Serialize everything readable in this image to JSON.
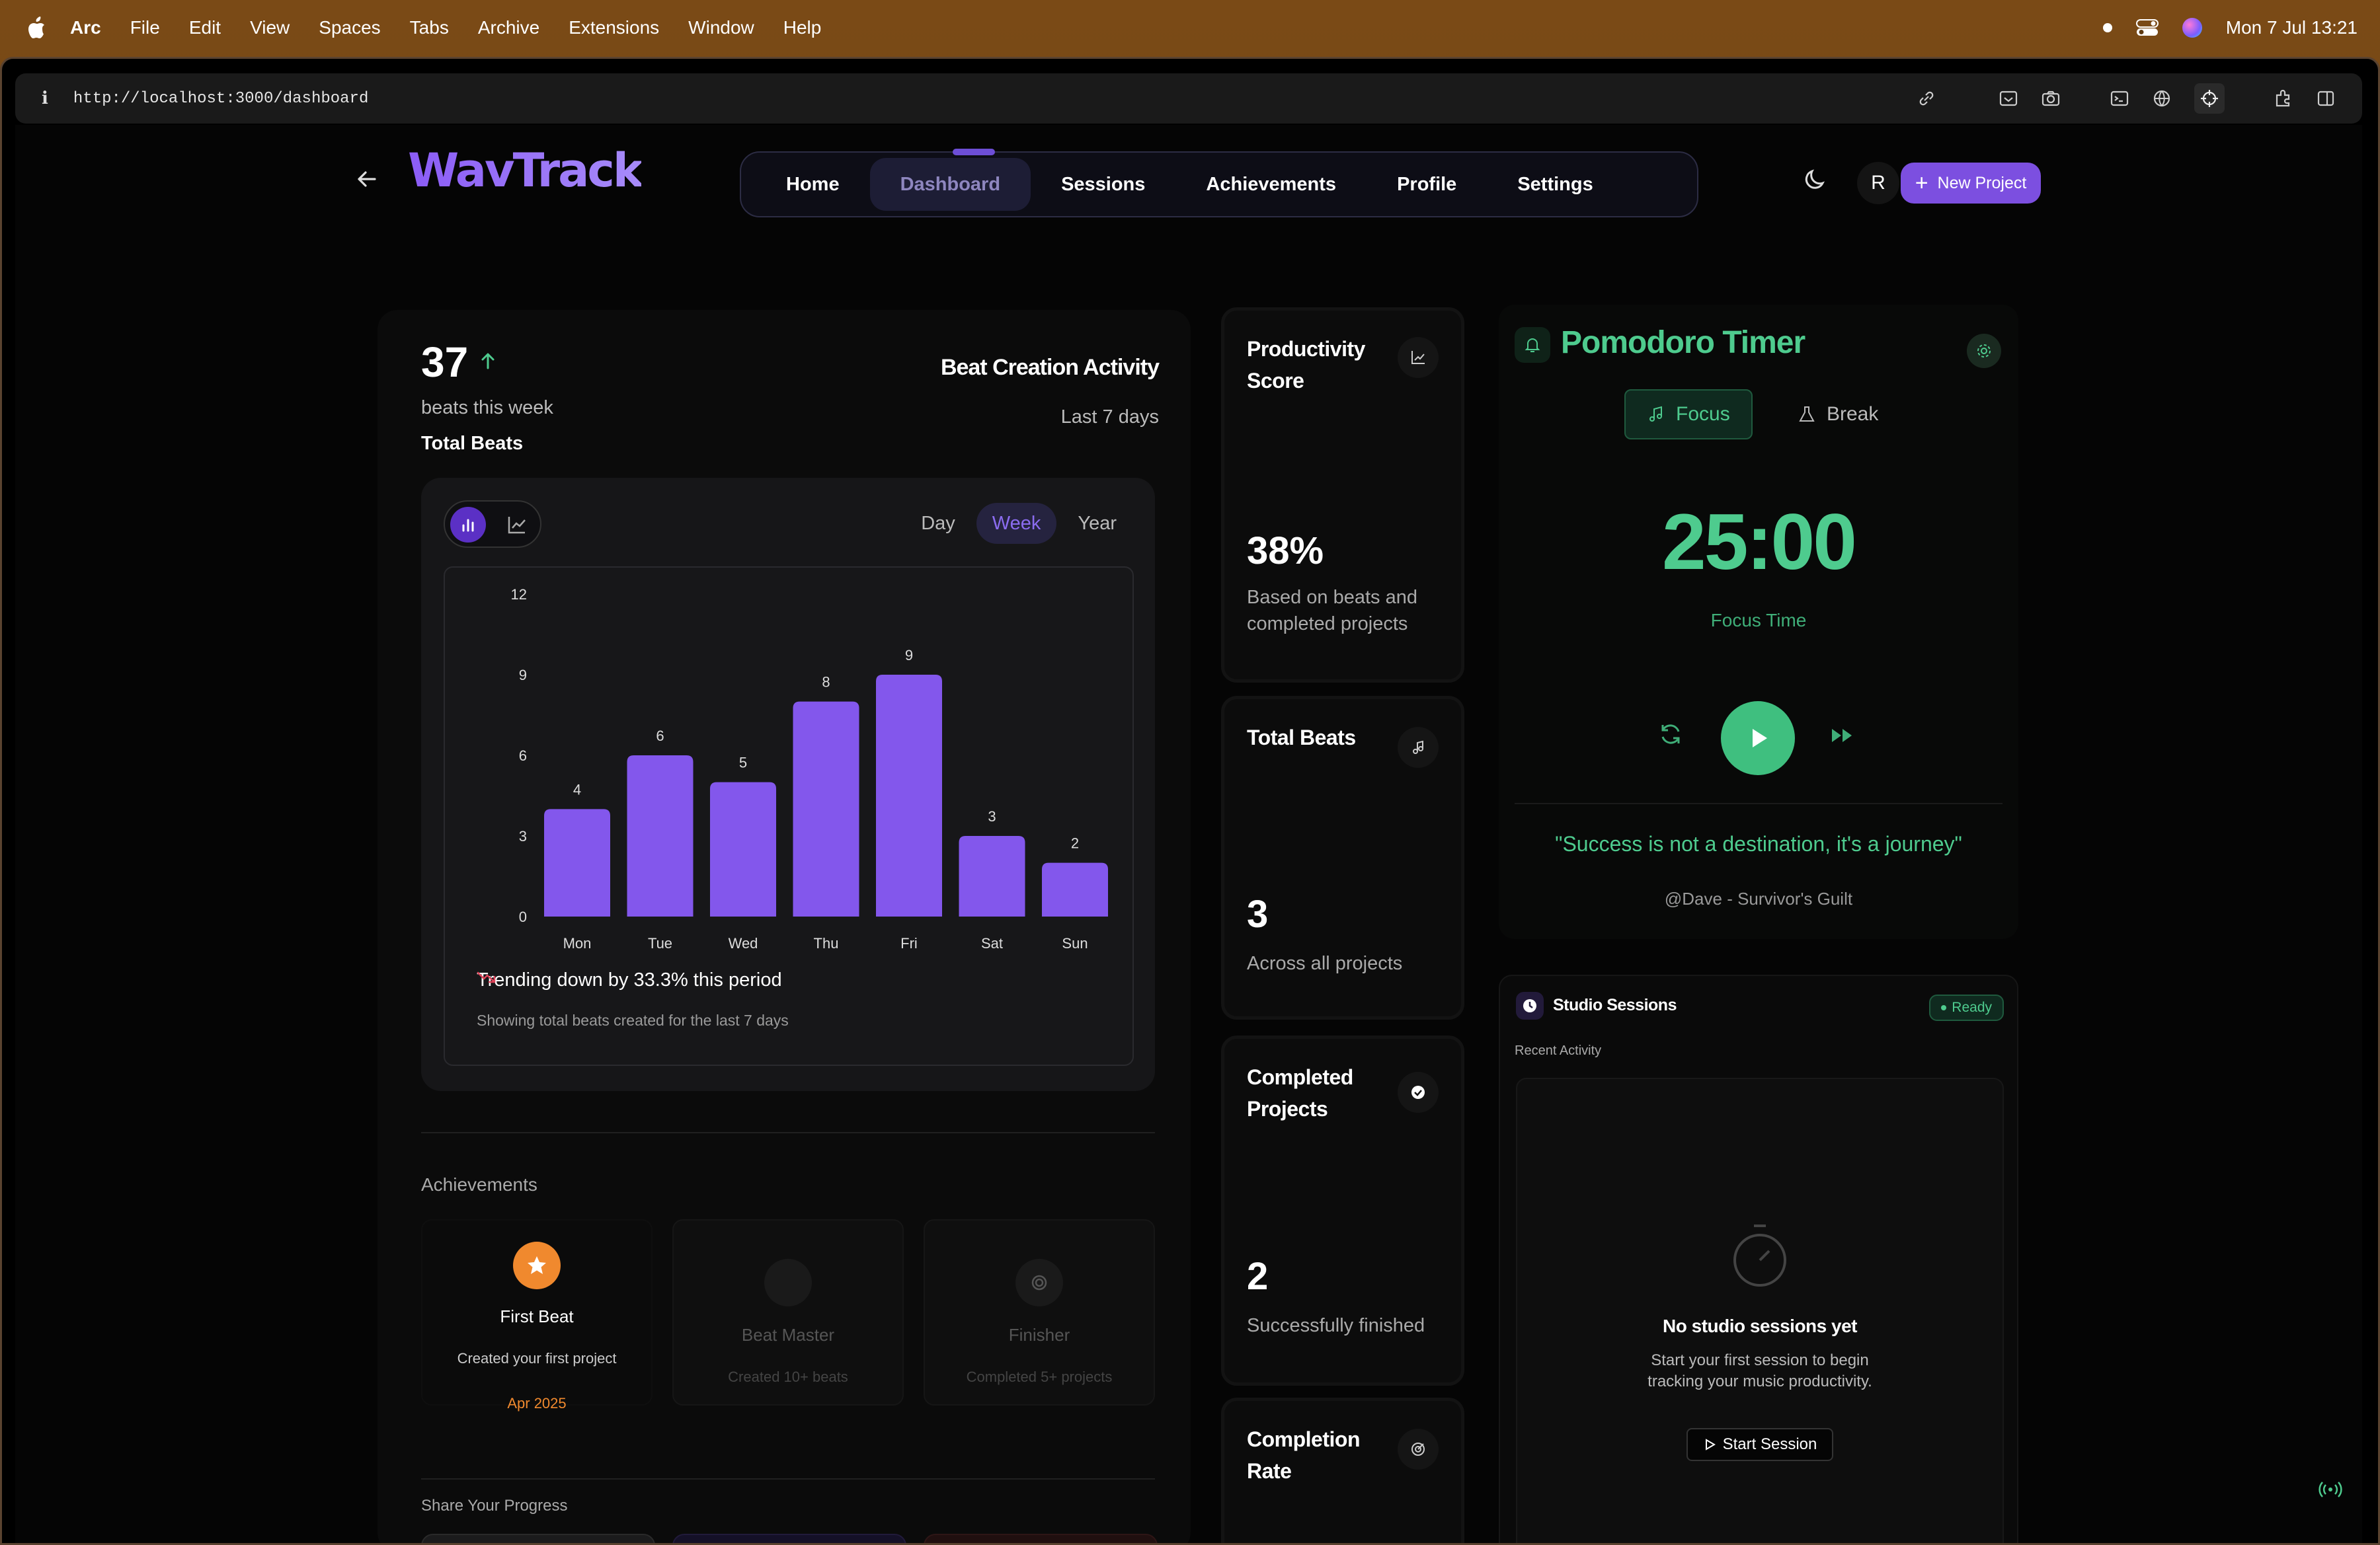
{
  "menubar": {
    "app": "Arc",
    "items": [
      "File",
      "Edit",
      "View",
      "Spaces",
      "Tabs",
      "Archive",
      "Extensions",
      "Window",
      "Help"
    ],
    "datetime": "Mon 7 Jul  13:21"
  },
  "browser": {
    "url": "http://localhost:3000/dashboard"
  },
  "header": {
    "logo": "WavTrack",
    "nav": [
      "Home",
      "Dashboard",
      "Sessions",
      "Achievements",
      "Profile",
      "Settings"
    ],
    "active_nav": "Dashboard",
    "avatar_initial": "R",
    "new_project_label": "New Project"
  },
  "summary": {
    "count": "37",
    "count_label": "beats this week",
    "total_label": "Total Beats",
    "activity_title": "Beat Creation Activity",
    "activity_range": "Last 7 days"
  },
  "periods": [
    "Day",
    "Week",
    "Year"
  ],
  "active_period": "Week",
  "chart_data": {
    "type": "bar",
    "categories": [
      "Mon",
      "Tue",
      "Wed",
      "Thu",
      "Fri",
      "Sat",
      "Sun"
    ],
    "values": [
      4,
      6,
      5,
      8,
      9,
      3,
      2
    ],
    "yticks": [
      "0",
      "3",
      "6",
      "9",
      "12"
    ],
    "ylim": [
      0,
      12
    ],
    "bar_color": "#8357ec",
    "show_data_labels": true
  },
  "trend": {
    "text": "Trending down by 33.3% this period",
    "note": "Showing total beats created for the last 7 days",
    "color": "#e0445a"
  },
  "achievements": {
    "title": "Achievements",
    "items": [
      {
        "name": "First Beat",
        "desc": "Created your first project",
        "date": "Apr 2025",
        "unlocked": true
      },
      {
        "name": "Beat Master",
        "desc": "Created 10+ beats",
        "date": "",
        "unlocked": false
      },
      {
        "name": "Finisher",
        "desc": "Completed 5+ projects",
        "date": "",
        "unlocked": false
      }
    ]
  },
  "share": {
    "title": "Share Your Progress"
  },
  "stats": [
    {
      "title": "Productivity Score",
      "value": "38%",
      "desc": "Based on beats and completed projects",
      "icon": "trend-icon"
    },
    {
      "title": "Total Beats",
      "value": "3",
      "desc": "Across all projects",
      "icon": "music-note-icon"
    },
    {
      "title": "Completed Projects",
      "value": "2",
      "desc": "Successfully finished",
      "icon": "check-circle-icon"
    },
    {
      "title": "Completion Rate",
      "value": "",
      "desc": "",
      "icon": "target-icon"
    }
  ],
  "pomodoro": {
    "title": "Pomodoro Timer",
    "focus_label": "Focus",
    "break_label": "Break",
    "time": "25:00",
    "mode_label": "Focus Time",
    "quote": "\"Success is not a destination, it's a journey\"",
    "quote_author": "@Dave - Survivor's Guilt",
    "accent": "#4ecb8e"
  },
  "studio": {
    "title": "Studio Sessions",
    "status": "Ready",
    "recent_label": "Recent Activity",
    "empty_title": "No studio sessions yet",
    "empty_line1": "Start your first session to begin",
    "empty_line2": "tracking your music productivity.",
    "start_label": "Start Session"
  }
}
